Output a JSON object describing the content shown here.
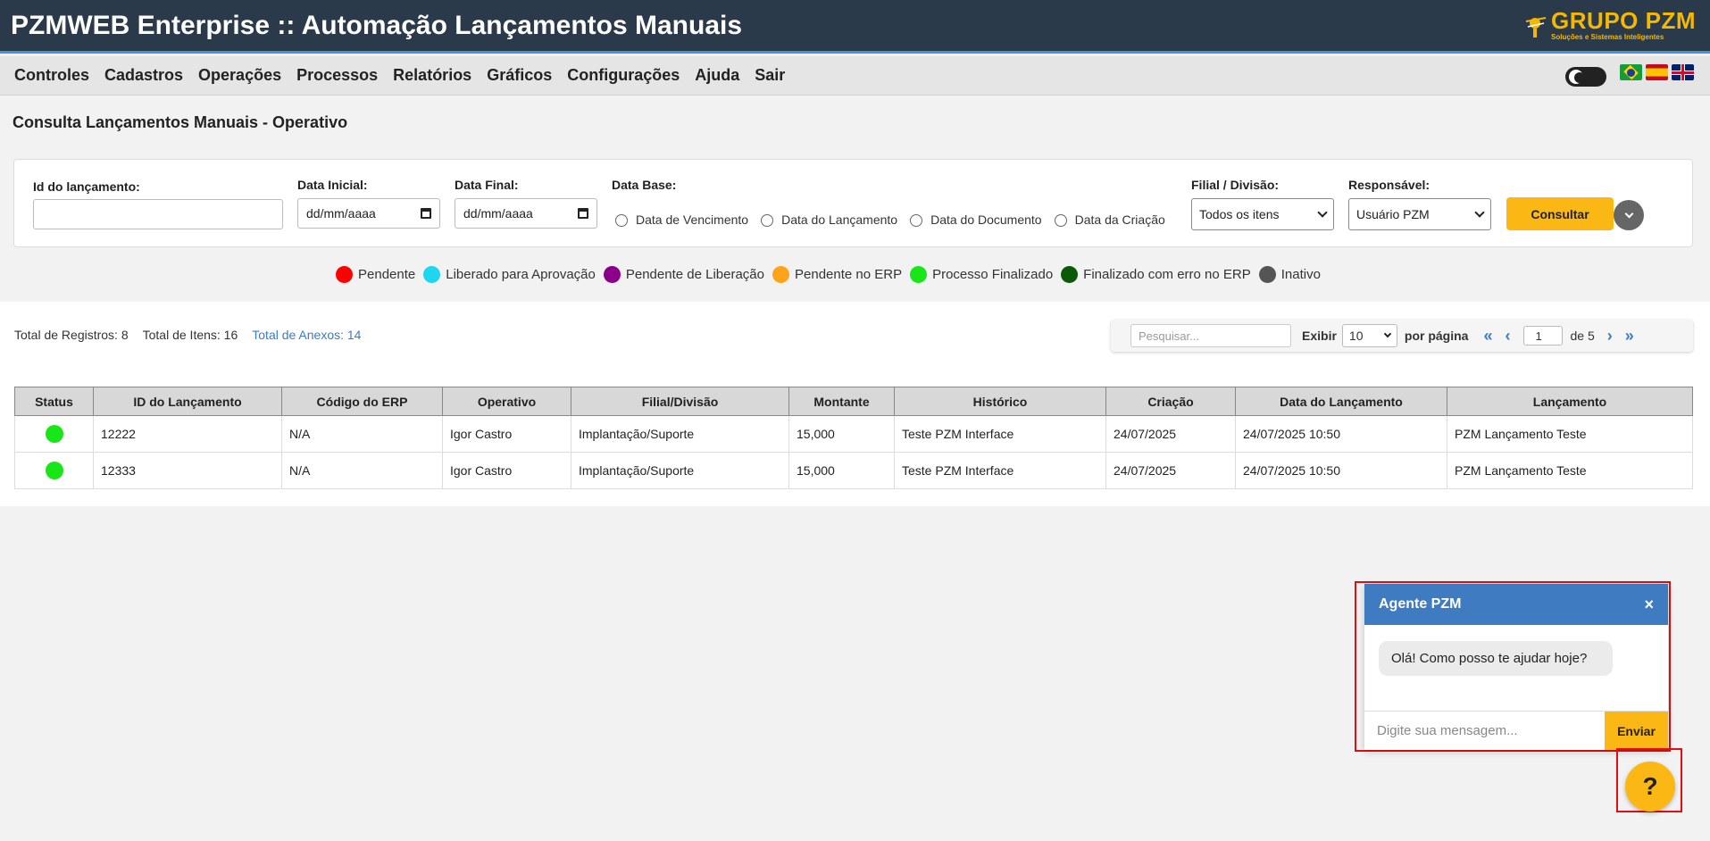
{
  "header": {
    "title": "PZMWEB Enterprise :: Automação Lançamentos Manuais",
    "logo_main": "GRUPO PZM",
    "logo_sub": "Soluções e Sistemas Inteligentes"
  },
  "menu": {
    "items": [
      "Controles",
      "Cadastros",
      "Operações",
      "Processos",
      "Relatórios",
      "Gráficos",
      "Configurações",
      "Ajuda",
      "Sair"
    ]
  },
  "page_title": "Consulta Lançamentos Manuais - Operativo",
  "filters": {
    "id_label": "Id do lançamento:",
    "id_value": "",
    "start_label": "Data Inicial:",
    "start_value": "dd/mm/aaaa",
    "end_label": "Data Final:",
    "end_value": "dd/mm/aaaa",
    "base_label": "Data Base:",
    "base_options": [
      "Data de Vencimento",
      "Data do Lançamento",
      "Data do Documento",
      "Data da Criação"
    ],
    "branch_label": "Filial / Divisão:",
    "branch_value": "Todos os itens",
    "responsible_label": "Responsável:",
    "responsible_value": "Usuário PZM",
    "submit_label": "Consultar"
  },
  "legend": [
    {
      "label": "Pendente",
      "color": "#ff0000"
    },
    {
      "label": "Liberado para Aprovação",
      "color": "#1ed6f0"
    },
    {
      "label": "Pendente de Liberação",
      "color": "#8a008a"
    },
    {
      "label": "Pendente no ERP",
      "color": "#ffa31a"
    },
    {
      "label": "Processo Finalizado",
      "color": "#19e619"
    },
    {
      "label": "Finalizado com erro no ERP",
      "color": "#0a5a0a"
    },
    {
      "label": "Inativo",
      "color": "#555555"
    }
  ],
  "totals": {
    "records": "Total de Registros: 8",
    "items": "Total de Itens: 16",
    "attachments": "Total de Anexos: 14"
  },
  "pager": {
    "search_placeholder": "Pesquisar...",
    "show_label": "Exibir",
    "per_page_value": "10",
    "per_page_label": "por página",
    "first": "«",
    "prev": "‹",
    "current_page": "1",
    "of_label": "de 5",
    "next": "›",
    "last": "»"
  },
  "table": {
    "columns": [
      "Status",
      "ID do Lançamento",
      "Código do ERP",
      "Operativo",
      "Filial/Divisão",
      "Montante",
      "Histórico",
      "Criação",
      "Data do Lançamento",
      "Lançamento"
    ],
    "rows": [
      {
        "status_color": "#19e619",
        "id": "12222",
        "erp": "N/A",
        "operativo": "Igor Castro",
        "filial": "Implantação/Suporte",
        "montante": "15,000",
        "historico": "Teste PZM Interface",
        "criacao": "24/07/2025",
        "data_lancamento": "24/07/2025 10:50",
        "lancamento": "PZM Lançamento Teste"
      },
      {
        "status_color": "#19e619",
        "id": "12333",
        "erp": "N/A",
        "operativo": "Igor Castro",
        "filial": "Implantação/Suporte",
        "montante": "15,000",
        "historico": "Teste PZM Interface",
        "criacao": "24/07/2025",
        "data_lancamento": "24/07/2025 10:50",
        "lancamento": "PZM Lançamento Teste"
      }
    ]
  },
  "chat": {
    "title": "Agente PZM",
    "close": "×",
    "message": "Olá! Como posso te ajudar hoje?",
    "input_placeholder": "Digite sua mensagem...",
    "send_label": "Enviar"
  },
  "help_button": "?"
}
